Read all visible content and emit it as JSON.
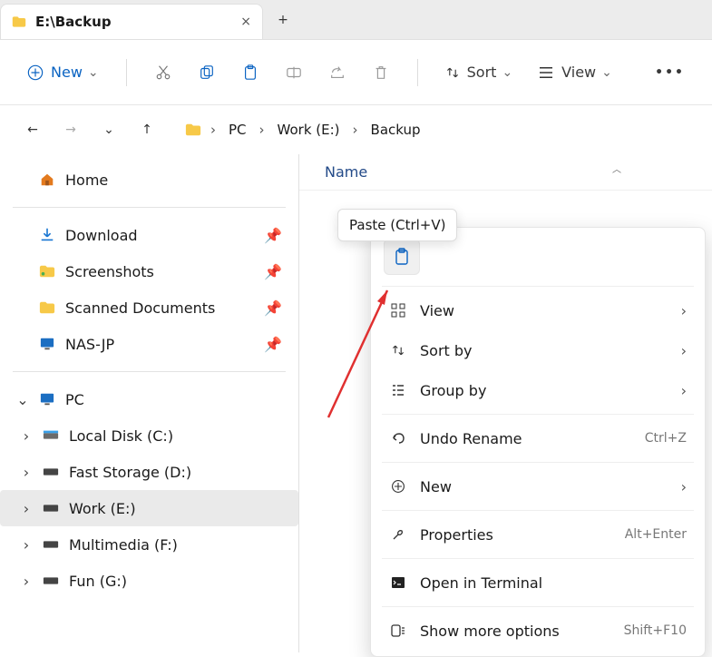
{
  "tab": {
    "title": "E:\\Backup",
    "close": "×",
    "new": "+"
  },
  "toolbar": {
    "new_label": "New",
    "sort_label": "Sort",
    "view_label": "View",
    "more": "•••"
  },
  "breadcrumb": {
    "segments": [
      "PC",
      "Work (E:)",
      "Backup"
    ]
  },
  "sidebar": {
    "home_label": "Home",
    "quick": [
      {
        "label": "Download"
      },
      {
        "label": "Screenshots"
      },
      {
        "label": "Scanned Documents"
      },
      {
        "label": "NAS-JP"
      }
    ],
    "pc_label": "PC",
    "drives": [
      {
        "label": "Local Disk (C:)"
      },
      {
        "label": "Fast Storage (D:)"
      },
      {
        "label": "Work (E:)",
        "selected": true
      },
      {
        "label": "Multimedia (F:)"
      },
      {
        "label": "Fun (G:)"
      }
    ]
  },
  "content": {
    "column_name": "Name"
  },
  "tooltip": "Paste (Ctrl+V)",
  "context_menu": {
    "view": "View",
    "sort_by": "Sort by",
    "group_by": "Group by",
    "undo": "Undo Rename",
    "undo_shortcut": "Ctrl+Z",
    "new": "New",
    "properties": "Properties",
    "properties_shortcut": "Alt+Enter",
    "terminal": "Open in Terminal",
    "more_options": "Show more options",
    "more_options_shortcut": "Shift+F10"
  }
}
